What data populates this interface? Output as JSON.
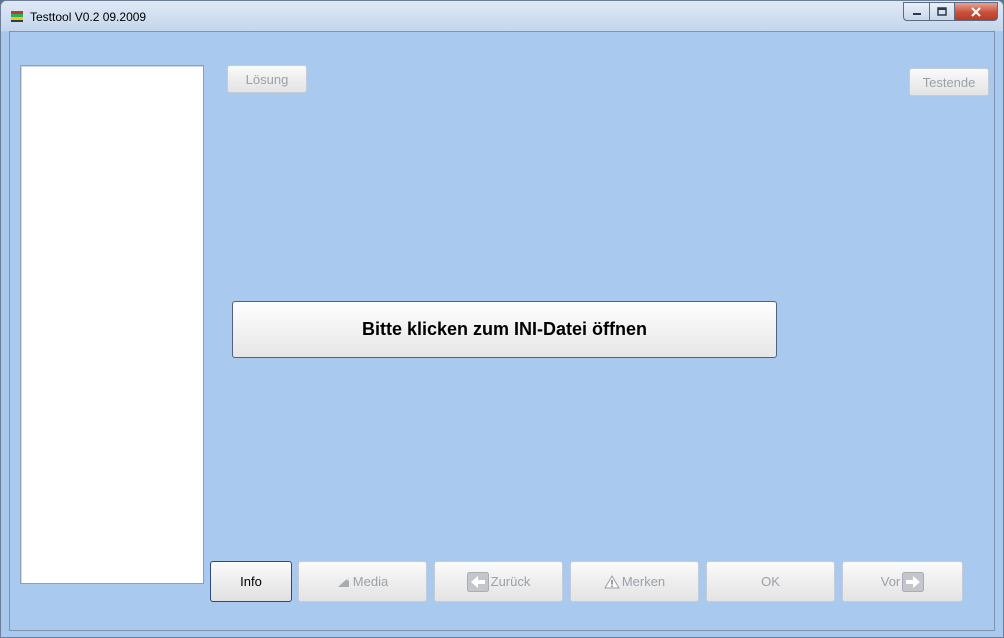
{
  "window": {
    "title": "Testtool V0.2 09.2009",
    "controls": {
      "minimize_icon": "minimize-icon",
      "maximize_icon": "maximize-icon",
      "close_icon": "close-icon"
    }
  },
  "top_buttons": {
    "loesung": "Lösung",
    "testende": "Testende"
  },
  "main": {
    "open_ini_button": "Bitte klicken zum INI-Datei öffnen"
  },
  "bottom_buttons": {
    "info": "Info",
    "media": "Media",
    "zurueck": "Zurück",
    "merken": "Merken",
    "ok": "OK",
    "vor": "Vor"
  },
  "colors": {
    "client_background": "#a9c9ef",
    "disabled_text": "#9aa1a8",
    "close_button": "#c7503a"
  }
}
